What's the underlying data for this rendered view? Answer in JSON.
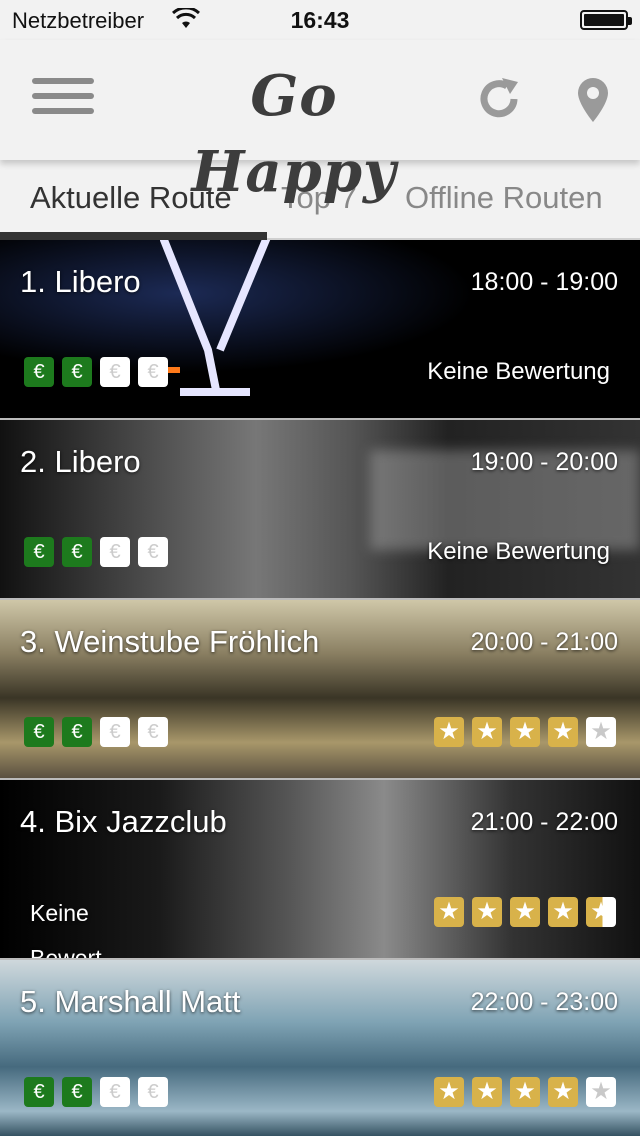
{
  "status_bar": {
    "carrier": "Netzbetreiber",
    "time": "16:43",
    "wifi_icon": "wifi-icon",
    "battery_icon": "battery-icon"
  },
  "navbar": {
    "menu_icon": "hamburger-menu-icon",
    "logo": "Go Happy",
    "refresh_icon": "refresh-icon",
    "location_icon": "location-pin-icon"
  },
  "tabs": [
    {
      "label": "Aktuelle Route",
      "active": true
    },
    {
      "label": "Top 7",
      "active": false
    },
    {
      "label": "Offline Routen",
      "active": false
    }
  ],
  "colors": {
    "price_active": "#1d7a1d",
    "star": "#d8b24a",
    "navbar_bg": "#f2f2f2"
  },
  "routes": [
    {
      "name": "1. Libero",
      "time": "18:00 - 19:00",
      "price": [
        "€",
        "€",
        "€",
        "€"
      ],
      "price_level": 2,
      "rating_text": "Keine Bewertung"
    },
    {
      "name": "2. Libero",
      "time": "19:00 - 20:00",
      "price": [
        "€",
        "€",
        "€",
        "€"
      ],
      "price_level": 2,
      "rating_text": "Keine Bewertung"
    },
    {
      "name": "3. Weinstube Fröhlich",
      "time": "20:00 - 21:00",
      "price": [
        "€",
        "€",
        "€",
        "€"
      ],
      "price_level": 2,
      "stars": 4,
      "star_max": 5
    },
    {
      "name": "4. Bix Jazzclub",
      "time": "21:00 - 22:00",
      "rating_text_left": "Keine",
      "rating_text_left_2": "Bewert",
      "stars": 4.5,
      "star_max": 5
    },
    {
      "name": "5. Marshall Matt",
      "time": "22:00 - 23:00",
      "price": [
        "€",
        "€",
        "€",
        "€"
      ],
      "price_level": 2,
      "stars": 4,
      "star_max": 5
    }
  ],
  "star_glyph": "★"
}
